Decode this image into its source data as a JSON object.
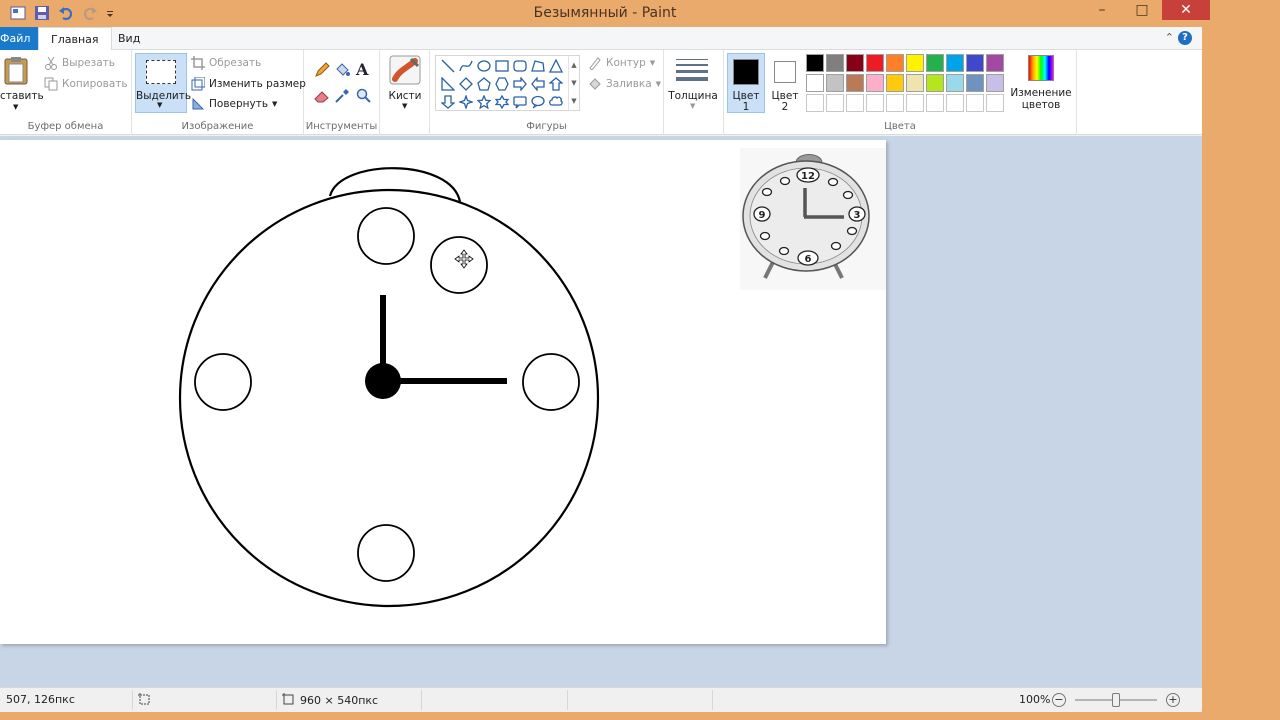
{
  "window": {
    "title": "Безымянный - Paint",
    "colors": {
      "titlebar": "#e9aa6b",
      "close": "#c7413a",
      "file_tab": "#1979ca"
    }
  },
  "tabs": [
    {
      "label": "Файл"
    },
    {
      "label": "Главная"
    },
    {
      "label": "Вид"
    }
  ],
  "ribbon": {
    "clipboard": {
      "label": "Буфер обмена",
      "paste": "ставить",
      "cut": "Вырезать",
      "copy": "Копировать"
    },
    "image": {
      "label": "Изображение",
      "select": "Выделить",
      "crop": "Обрезать",
      "resize": "Изменить размер",
      "rotate": "Повернуть"
    },
    "tools": {
      "label": "Инструменты"
    },
    "brushes": {
      "label": "Кисти"
    },
    "shapes": {
      "label": "Фигуры",
      "outline": "Контур",
      "fill": "Заливка"
    },
    "size": {
      "label": "Толщина"
    },
    "colors": {
      "label": "Цвета",
      "color1": "Цвет 1",
      "color2": "Цвет 2",
      "edit": "Изменение цветов",
      "color1_value": "#000000",
      "color2_value": "#ffffff",
      "palette_row1": [
        "#000000",
        "#7f7f7f",
        "#880015",
        "#ed1c24",
        "#ff7f27",
        "#fff200",
        "#22b14c",
        "#00a2e8",
        "#3f48cc",
        "#a349a4"
      ],
      "palette_row2": [
        "#ffffff",
        "#c3c3c3",
        "#b97a57",
        "#ffaec9",
        "#ffc90e",
        "#efe4b0",
        "#b5e61d",
        "#99d9ea",
        "#7092be",
        "#c8bfe7"
      ],
      "palette_row3": [
        "#ffffff",
        "#ffffff",
        "#ffffff",
        "#ffffff",
        "#ffffff",
        "#ffffff",
        "#ffffff",
        "#ffffff",
        "#ffffff",
        "#ffffff"
      ]
    }
  },
  "canvas": {
    "reference_numbers": [
      "12",
      "3",
      "6",
      "9"
    ]
  },
  "status": {
    "cursor_pos": "507, 126пкс",
    "image_size": "960 × 540пкс",
    "zoom": "100%"
  }
}
